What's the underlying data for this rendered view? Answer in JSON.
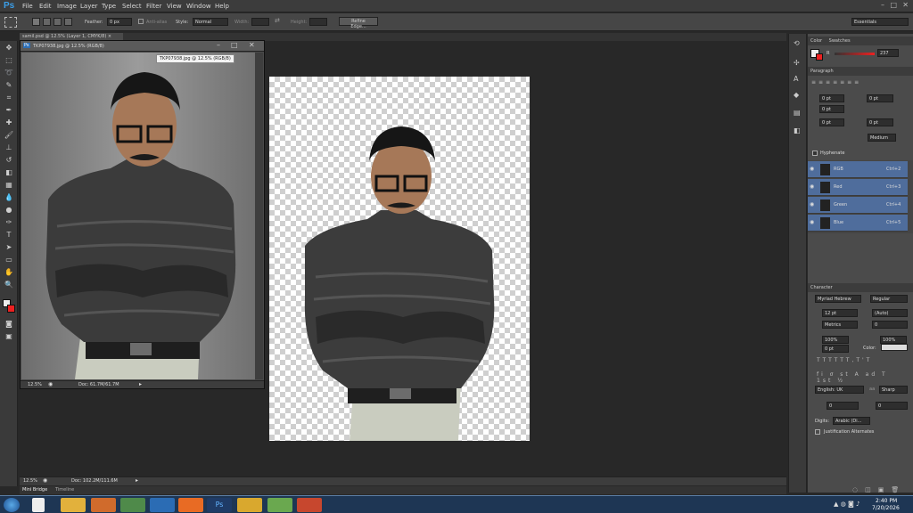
{
  "menubar": {
    "logo": "Ps",
    "items": [
      "File",
      "Edit",
      "Image",
      "Layer",
      "Type",
      "Select",
      "Filter",
      "View",
      "Window",
      "Help"
    ]
  },
  "options": {
    "feather_label": "Feather:",
    "feather_value": "0 px",
    "antialias_label": "Anti-alias",
    "style_label": "Style:",
    "style_value": "Normal",
    "width_label": "Width:",
    "height_label": "Height:",
    "refine_button": "Refine Edge...",
    "workspace": "Essentials"
  },
  "tabs": {
    "active": "samil.psd @ 12.5% (Layer 1, CMYK/8)"
  },
  "docwindow": {
    "title": "TKP07938.jpg @ 12.5% (RGB/8)",
    "tooltip": "TKP07938.jpg @ 12.5% (RGB/8)",
    "zoom": "12.5%",
    "doc": "Doc: 61.7M/61.7M"
  },
  "status": {
    "zoom": "12.5%",
    "doc": "Doc: 102.2M/111.6M"
  },
  "bottomtabs": [
    "Mini Bridge",
    "Timeline"
  ],
  "color_panel": {
    "tabs": [
      "Color",
      "Swatches"
    ],
    "channel": "R",
    "value": "237"
  },
  "paragraph": {
    "tab": "Paragraph",
    "fields": [
      "0 pt",
      "0 pt",
      "0 pt",
      "0 pt",
      "0 pt"
    ],
    "mode": "Medium",
    "hyphenate": "Hyphenate"
  },
  "channels": [
    {
      "name": "RGB",
      "shortcut": "Ctrl+2"
    },
    {
      "name": "Red",
      "shortcut": "Ctrl+3"
    },
    {
      "name": "Green",
      "shortcut": "Ctrl+4"
    },
    {
      "name": "Blue",
      "shortcut": "Ctrl+5"
    }
  ],
  "character": {
    "tab": "Character",
    "font": "Myriad Hebrew",
    "style": "Regular",
    "size": "12 pt",
    "leading": "(Auto)",
    "kerning": "Metrics",
    "tracking": "0",
    "vscale": "100%",
    "hscale": "100%",
    "baseline": "0 pt",
    "color_label": "Color:",
    "language": "English: UK",
    "aa": "Sharp",
    "f1": "0",
    "f2": "0",
    "digits_label": "Digits:",
    "digits": "Arabic (Di...",
    "justification": "Justification Alternates",
    "aa_label": "aa"
  },
  "taskbar": {
    "time": "2:40 PM",
    "date": "7/20/2026"
  },
  "colors": {
    "accent": "#4f6d9c",
    "foreground": "#ed2020"
  }
}
